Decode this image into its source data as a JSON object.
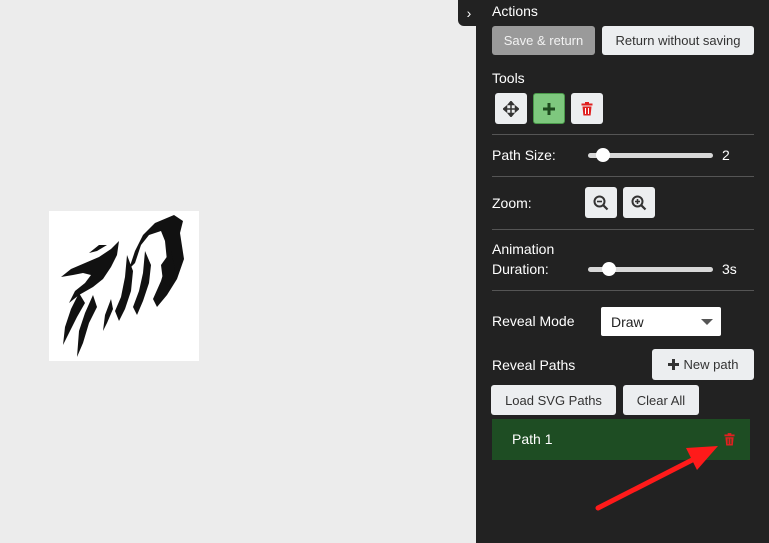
{
  "panel": {
    "actions_title": "Actions",
    "save_return_label": "Save & return",
    "return_without_saving_label": "Return without saving",
    "tools_title": "Tools",
    "path_size_label": "Path Size:",
    "path_size_value": "2",
    "path_size_level": 0.07,
    "zoom_label": "Zoom:",
    "animation_label_line1": "Animation",
    "animation_label_line2": "Duration:",
    "animation_value": "3s",
    "animation_level": 0.13,
    "reveal_mode_label": "Reveal Mode",
    "reveal_mode_value": "Draw",
    "reveal_paths_label": "Reveal Paths",
    "new_path_label": "New path",
    "load_svg_label": "Load SVG Paths",
    "clear_all_label": "Clear All",
    "paths": [
      {
        "label": "Path 1"
      }
    ]
  },
  "colors": {
    "panel_bg": "#222222",
    "path_row_bg": "#1e4d23",
    "delete_red": "#e02020",
    "annotation_arrow": "#ff1a1a",
    "tool_active_green": "#7ec87e"
  },
  "icons": {
    "toggle": "chevron-right-icon",
    "move_tool": "move-arrows-icon",
    "add_tool": "plus-icon",
    "delete_tool": "trash-icon",
    "zoom_out": "zoom-out-icon",
    "zoom_in": "zoom-in-icon",
    "new_path": "plus-icon",
    "path_delete": "trash-icon"
  }
}
